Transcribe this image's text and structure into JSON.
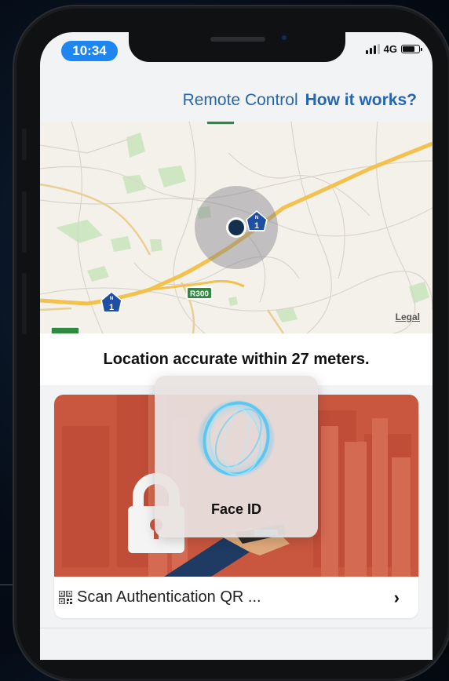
{
  "status_bar": {
    "time": "10:34",
    "network": "4G",
    "signal_bars": 3,
    "battery_level": 0.75
  },
  "header": {
    "title": "Remote Control",
    "link_label": "How it works?",
    "accent_color": "#2566b0"
  },
  "map": {
    "route_labels": [
      "1",
      "1",
      "R300"
    ],
    "legal_label": "Legal",
    "road_color": "#f2c14e"
  },
  "location": {
    "accuracy_text": "Location accurate within 27 meters."
  },
  "card": {
    "label": "Scan Authentication QR ...",
    "icon": "qr-code-icon",
    "chevron": "›",
    "image_color": "#c9573f"
  },
  "face_id": {
    "label": "Face ID",
    "icon": "face-id-icon"
  }
}
